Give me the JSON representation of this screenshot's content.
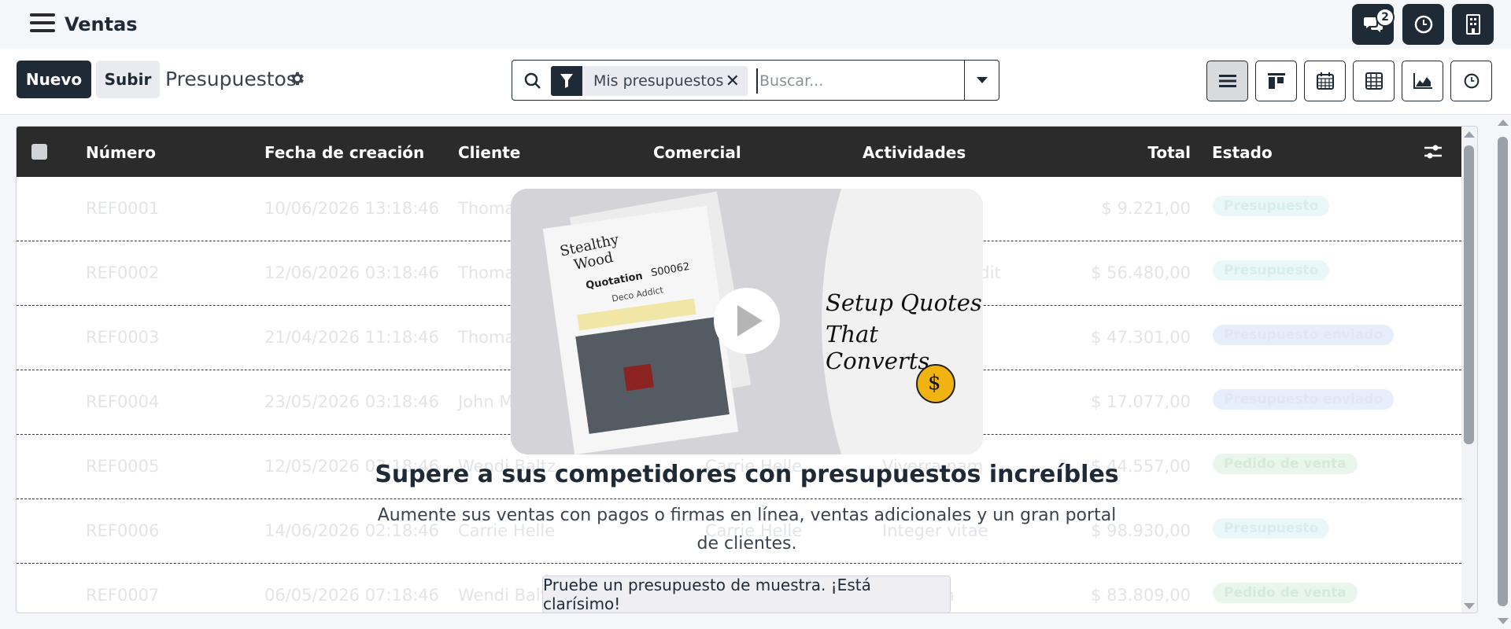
{
  "navbar": {
    "app_title": "Ventas",
    "messages_badge": "2"
  },
  "control_panel": {
    "new_label": "Nuevo",
    "upload_label": "Subir",
    "breadcrumb": "Presupuestos",
    "search": {
      "facet_label": "Mis presupuestos",
      "placeholder": "Buscar..."
    }
  },
  "list": {
    "columns": {
      "number": "Número",
      "created": "Fecha de creación",
      "client": "Cliente",
      "salesperson": "Comercial",
      "activities": "Actividades",
      "total": "Total",
      "state": "Estado"
    },
    "rows": [
      {
        "number": "REF0001",
        "created": "10/06/2026 13:18:46",
        "client": "Thoma",
        "salesperson": "",
        "activities": "",
        "total": "$ 9.221,00",
        "state": "Presupuesto"
      },
      {
        "number": "REF0002",
        "created": "12/06/2026 03:18:46",
        "client": "Thoma",
        "salesperson": "",
        "activities": "ndit",
        "total": "$ 56.480,00",
        "state": "Presupuesto"
      },
      {
        "number": "REF0003",
        "created": "21/04/2026 11:18:46",
        "client": "Thoma",
        "salesperson": "",
        "activities": "",
        "total": "$ 47.301,00",
        "state": "Presupuesto enviado"
      },
      {
        "number": "REF0004",
        "created": "23/05/2026 03:18:46",
        "client": "John M",
        "salesperson": "",
        "activities": "",
        "total": "$ 17.077,00",
        "state": "Presupuesto enviado"
      },
      {
        "number": "REF0005",
        "created": "12/05/2026 03:18:46",
        "client": "Wendi Baltz",
        "salesperson": "Carrie Helle",
        "activities": "Viverra nam",
        "total": "$ 44.557,00",
        "state": "Pedido de venta"
      },
      {
        "number": "REF0006",
        "created": "14/06/2026 02:18:46",
        "client": "Carrie Helle",
        "salesperson": "Carrie Helle",
        "activities": "Integer vitae",
        "total": "$ 98.930,00",
        "state": "Presupuesto"
      },
      {
        "number": "REF0007",
        "created": "06/05/2026 07:18:46",
        "client": "Wendi Balt",
        "salesperson": "",
        "activities": "ham",
        "total": "$ 83.809,00",
        "state": "Pedido de venta"
      }
    ]
  },
  "helper": {
    "video": {
      "brand_line1": "Stealthy",
      "brand_line2": "Wood",
      "doc_title": "Quotation",
      "doc_number": "S00062",
      "doc_customer": "Deco Addict",
      "caption_line1": "Setup Quotes",
      "caption_line2": "That Converts",
      "coin_symbol": "$"
    },
    "headline": "Supere a sus competidores con presupuestos increíbles",
    "subtext": "Aumente sus ventas con pagos o firmas en línea, ventas adicionales y un gran portal de clientes.",
    "sample_button": "Pruebe un presupuesto de muestra. ¡Está clarísimo!"
  },
  "colors": {
    "dark": "#1f2a37",
    "header_bg": "#2b2b2b",
    "page_bg": "#f5f6f9"
  }
}
